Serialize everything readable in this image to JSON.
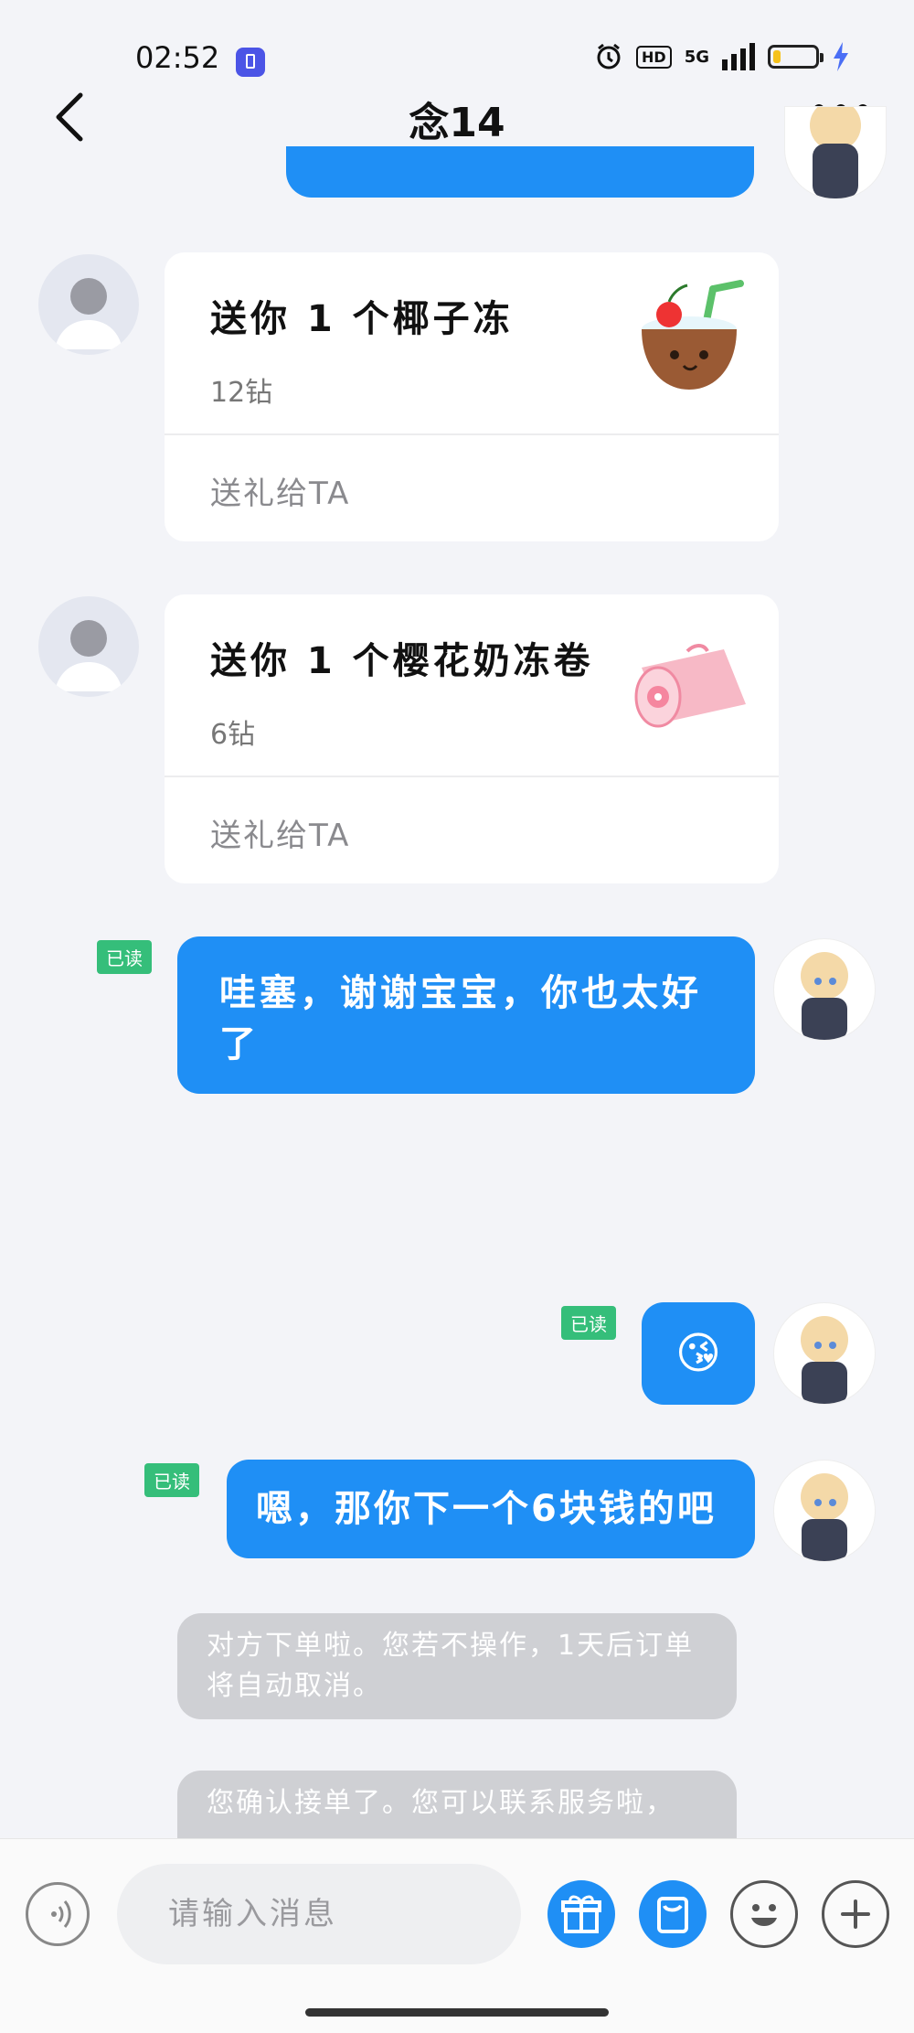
{
  "status_bar": {
    "time": "02:52",
    "network": "5G",
    "hd": "HD",
    "battery_level": 0.18
  },
  "header": {
    "title": "念14"
  },
  "gifts": [
    {
      "text": "送你 1 个椰子冻",
      "price": "12钻",
      "action": "送礼给TA",
      "icon": "coconut-jelly-icon"
    },
    {
      "text": "送你 1 个樱花奶冻卷",
      "price": "6钻",
      "action": "送礼给TA",
      "icon": "sakura-roll-icon"
    }
  ],
  "messages": [
    {
      "text": "哇塞，谢谢宝宝，你也太好了",
      "status": "已读"
    },
    {
      "text": "😘",
      "status": "已读"
    },
    {
      "text": "嗯，那你下一个6块钱的吧",
      "status": "已读"
    }
  ],
  "system_messages": [
    {
      "text": "对方下单啦。您若不操作，1天后订单将自动取消。"
    },
    {
      "text": "您确认接单了。您可以联系服务啦，"
    }
  ],
  "input": {
    "placeholder": "请输入消息"
  },
  "colors": {
    "bubble_blue": "#1f8ff5",
    "read_green": "#35be7a",
    "system_gray": "#cfd0d4"
  }
}
